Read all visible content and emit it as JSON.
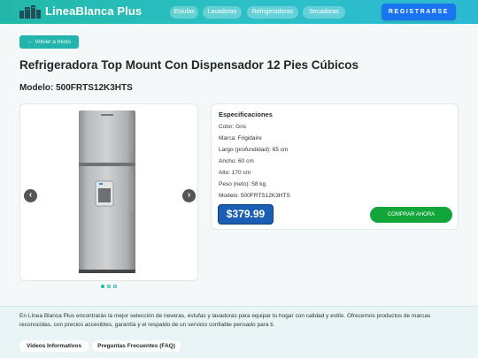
{
  "header": {
    "brand": "LineaBlanca Plus",
    "nav": [
      "Estufas",
      "Lavadoras",
      "Refrigeradoras",
      "Secadoras"
    ],
    "cta": "REGISTRARSE"
  },
  "back_button": "← Volver a Inicio",
  "product": {
    "title": "Refrigeradora Top Mount Con Dispensador 12 Pies Cúbicos",
    "model_line": "Modelo: 500FRTS12K3HTS",
    "carousel": {
      "prev_icon": "chevron-left",
      "next_icon": "chevron-right",
      "total_slides": 3,
      "active_slide": 1
    }
  },
  "specs": {
    "title": "Especificaciones",
    "lines": [
      "Color: Gris",
      "Marca: Frigidaire",
      "Largo (profundidad): 65 cm",
      "Ancho: 60 cm",
      "Alto: 170 cm",
      "Peso (neto): 58 kg",
      "Modelo: 500FRTS12K3HTS"
    ],
    "price": "$379.99",
    "buy_label": "COMPRAR AHORA"
  },
  "footer": {
    "text": "En Línea Blanca Plus encontrarás la mejor selección de neveras, estufas y lavadoras para equipar tu hogar con calidad y estilo. Ofrecemos productos de marcas reconocidas, con precios accesibles, garantía y el respaldo de un servicio confiable pensado para ti.",
    "links": [
      "Videos Informativos",
      "Preguntas Frecuentes (FAQ)"
    ]
  },
  "colors": {
    "header_gradient": "#22b8a8",
    "accent": "#22b5ad",
    "cta_blue": "#1a73f0",
    "price_blue": "#1a5fb4",
    "buy_green": "#12a63a"
  }
}
